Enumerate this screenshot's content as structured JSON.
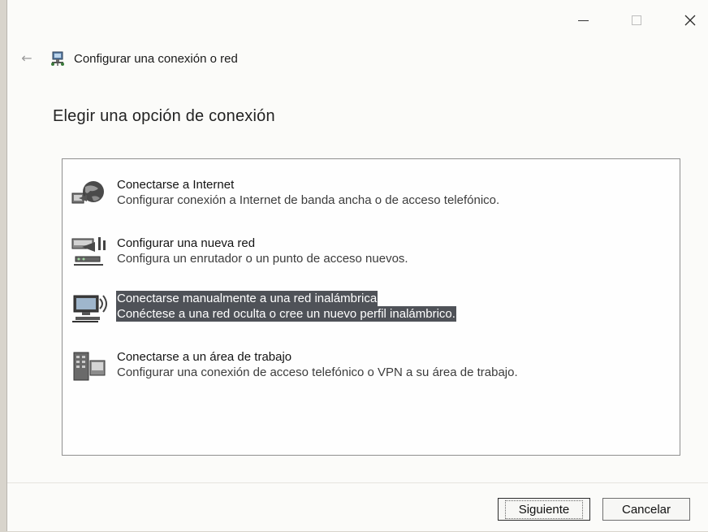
{
  "window": {
    "controls": {
      "minimize_icon": "minimize-icon",
      "maximize_icon": "maximize-icon",
      "close_glyph": "✕"
    }
  },
  "nav": {
    "back_glyph": "←",
    "title": "Configurar una conexión o red"
  },
  "heading": "Elegir una opción de conexión",
  "options": [
    {
      "title": "Conectarse a Internet",
      "description": "Configurar conexión a Internet de banda ancha o de acceso telefónico.",
      "icon": "globe-network-icon",
      "selected": false
    },
    {
      "title": "Configurar una nueva red",
      "description": "Configura un enrutador o un punto de acceso nuevos.",
      "icon": "router-icon",
      "selected": false
    },
    {
      "title": "Conectarse manualmente a una red inalámbrica",
      "description": "Conéctese a una red oculta o cree un nuevo perfil inalámbrico.",
      "icon": "wireless-computer-icon",
      "selected": true
    },
    {
      "title": "Conectarse a un área de trabajo",
      "description": "Configurar una conexión de acceso telefónico o VPN a su área de trabajo.",
      "icon": "workplace-icon",
      "selected": false
    }
  ],
  "buttons": {
    "next": "Siguiente",
    "cancel": "Cancelar"
  },
  "colors": {
    "selection": "#4f5258",
    "window_bg": "#fbfbf9"
  }
}
